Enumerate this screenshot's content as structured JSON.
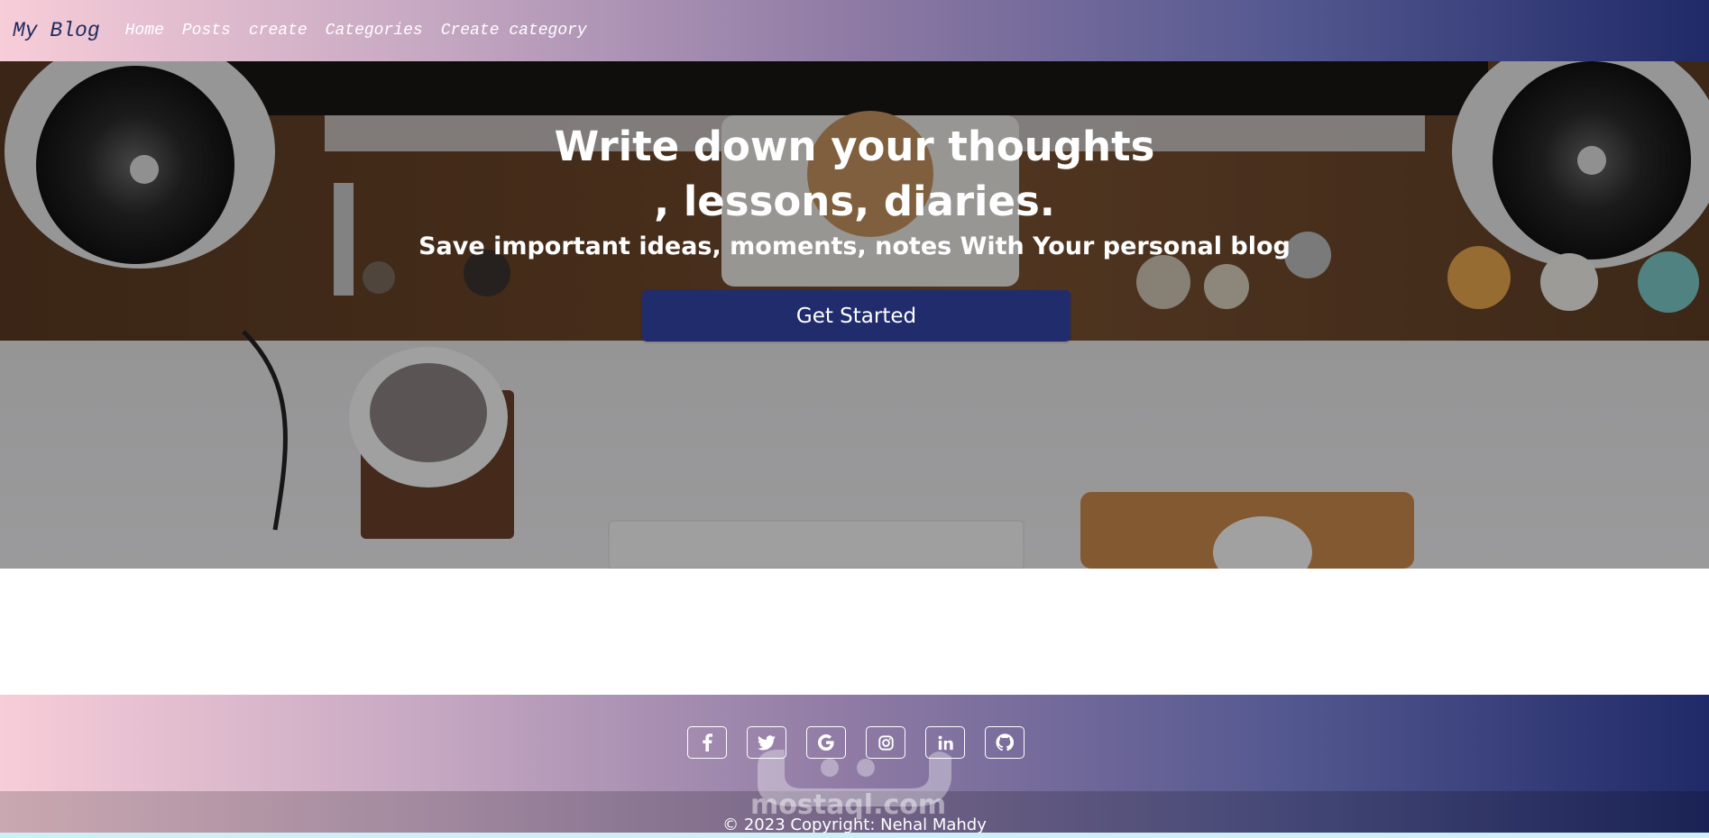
{
  "navbar": {
    "brand": "My Blog",
    "links": [
      "Home",
      "Posts",
      "create",
      "Categories",
      "Create category"
    ]
  },
  "hero": {
    "title_line1": "Write down your thoughts",
    "title_line2": ", lessons, diaries.",
    "subtitle_part1": "Save important ideas, moments, notes ",
    "subtitle_bold": "With",
    "subtitle_part2": " Your personal blog",
    "cta_label": "Get Started"
  },
  "footer": {
    "socials": [
      "facebook-icon",
      "twitter-icon",
      "google-icon",
      "instagram-icon",
      "linkedin-icon",
      "github-icon"
    ],
    "copyright": "© 2023 Copyright: Nehal Mahdy",
    "watermark": "mostaql.com"
  },
  "colors": {
    "primary": "#212c6c",
    "gradient_start": "#f7cdd8",
    "gradient_end": "#202a68"
  }
}
